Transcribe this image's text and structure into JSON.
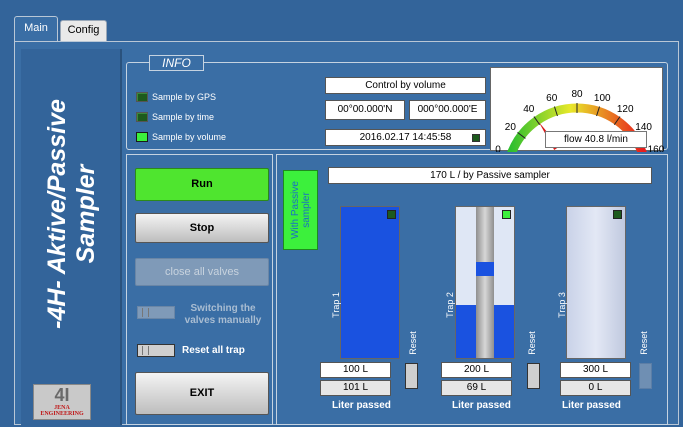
{
  "tabs": [
    {
      "label": "Main"
    },
    {
      "label": "Config"
    }
  ],
  "app": {
    "title": "-4H- Aktive/Passive\nSampler",
    "logo_mark": "4I",
    "logo_text": "JENA ENGINEERING"
  },
  "info": {
    "label": "INFO",
    "sample_by_gps": "Sample by GPS",
    "sample_by_time": "Sample by time",
    "sample_by_volume": "Sample by volume",
    "control_mode": "Control by volume",
    "latitude": "00°00.000'N",
    "longitude": "000°00.000'E",
    "datetime": "2016.02.17 14:45:58"
  },
  "gauge": {
    "ticks": [
      "0",
      "20",
      "40",
      "60",
      "80",
      "100",
      "120",
      "140",
      "160"
    ],
    "readout": "flow 40.8 l/min",
    "value": 40.8,
    "max": 160
  },
  "controls": {
    "run": "Run",
    "stop": "Stop",
    "close_all_valves": "close all valves",
    "switching_manual": "Switching the\nvalves manually",
    "reset_all_trap": "Reset all trap",
    "exit": "EXIT"
  },
  "traps": {
    "status": "170 L / by Passive sampler",
    "passive_label": "With Passive\nsampler",
    "reset_label": "Reset",
    "passed_label": "Liter   passed",
    "items": [
      {
        "name": "Trap 1",
        "target": "100 L",
        "passed": "101 L",
        "fill": 1.0
      },
      {
        "name": "Trap 2",
        "target": "200 L",
        "passed": "69 L",
        "fill": 0.35
      },
      {
        "name": "Trap 3",
        "target": "300 L",
        "passed": "0 L",
        "fill": 0.0
      }
    ]
  },
  "colors": {
    "led_on": "#3cf03c",
    "run_button": "#4fe52f",
    "tank_fill": "#1a52e0",
    "background": "#3a6ea5"
  }
}
